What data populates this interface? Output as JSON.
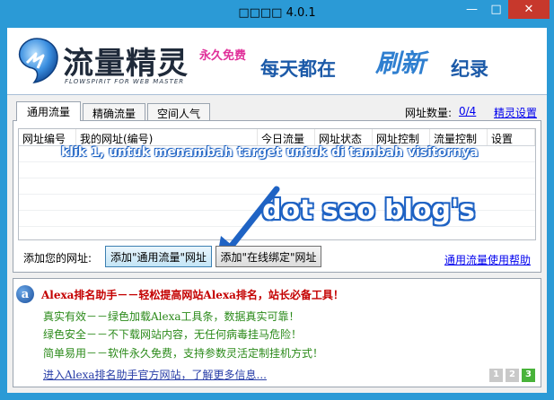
{
  "window": {
    "title": "□□□□ 4.0.1",
    "minimize_glyph": "—",
    "maximize_glyph": "□",
    "close_glyph": "✕"
  },
  "banner": {
    "logo_text": "流量精灵",
    "logo_subtitle": "FLOWSPIRIT FOR WEB MASTER",
    "free_badge": "永久免费",
    "slogan_a": "每天都在",
    "slogan_b": "刷新",
    "slogan_c": "纪录"
  },
  "tabs": [
    {
      "label": "通用流量",
      "active": true
    },
    {
      "label": "精确流量",
      "active": false
    },
    {
      "label": "空间人气",
      "active": false
    }
  ],
  "counter": {
    "label": "网址数量:",
    "value": "0/4"
  },
  "settings_link": "精灵设置",
  "table": {
    "columns": [
      "网址编号",
      "我的网址(编号)",
      "今日流量",
      "网址状态",
      "网址控制",
      "流量控制",
      "设置"
    ]
  },
  "annotations": {
    "instruction": "klik 1, untuk menambah target untuk di tambah visitornya",
    "watermark": "dot seo blog's"
  },
  "add": {
    "label": "添加您的网址:",
    "button_general": "添加\"通用流量\"网址",
    "button_online": "添加\"在线绑定\"网址"
  },
  "help_link": "通用流量使用帮助",
  "info": {
    "title": "Alexa排名助手－－轻松提高网站Alexa排名，站长必备工具！",
    "lines": [
      "真实有效－－绿色加载Alexa工具条，数据真实可靠！",
      "绿色安全－－不下载网站内容，无任何病毒挂马危险！",
      "简单易用－－软件永久免费，支持参数灵活定制挂机方式！"
    ],
    "link": "进入Alexa排名助手官方网站，了解更多信息...",
    "pages": [
      "1",
      "2",
      "3"
    ]
  },
  "colors": {
    "frame": "#2b9ad6",
    "close": "#c7382c",
    "accent_red": "#c40000",
    "accent_green": "#2b8a1a",
    "link_blue": "#0000ee",
    "active_page": "#49b33a"
  }
}
